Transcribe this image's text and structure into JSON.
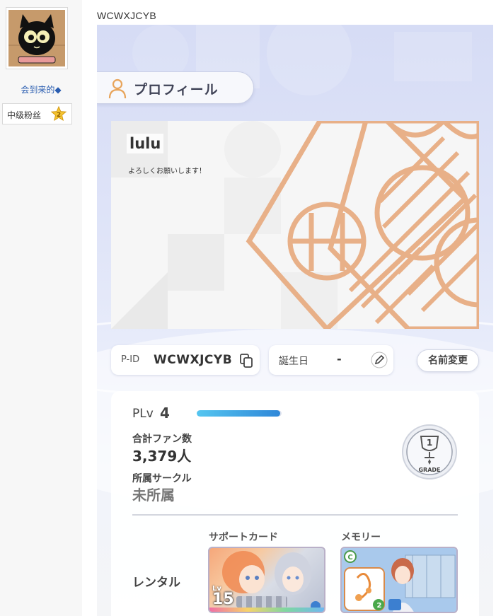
{
  "sidebar": {
    "username": "会到来的◆",
    "rank": {
      "label": "中级粉丝",
      "level": "2"
    }
  },
  "post": {
    "title": "WCWXJCYB"
  },
  "game": {
    "header": {
      "title": "プロフィール"
    },
    "banner": {
      "name": "lulu",
      "comment": "よろしくお願いします！"
    },
    "id_row": {
      "label": "P-ID",
      "value": "WCWXJCYB"
    },
    "birthday": {
      "label": "誕生日",
      "value": "-"
    },
    "rename_button": "名前変更",
    "stats": {
      "plv_label": "PLv",
      "plv_value": "4",
      "plv_progress": 0.98,
      "fans_label": "合計ファン数",
      "fans_value": "3,379人",
      "circle_label": "所属サークル",
      "circle_value": "未所属",
      "grade": {
        "number": "1",
        "label": "GRADE"
      }
    },
    "rental": {
      "label": "レンタル",
      "support_card": {
        "label": "サポートカード",
        "lv_label": "Lv",
        "lv_value": "15"
      },
      "memory": {
        "label": "メモリー",
        "badge": "C",
        "count": "2"
      }
    }
  },
  "colors": {
    "accent_orange": "#e8b088",
    "bar_blue": "#2f87d8",
    "link_blue": "#2a5db0",
    "panel_bg": "#d6dcf5"
  }
}
